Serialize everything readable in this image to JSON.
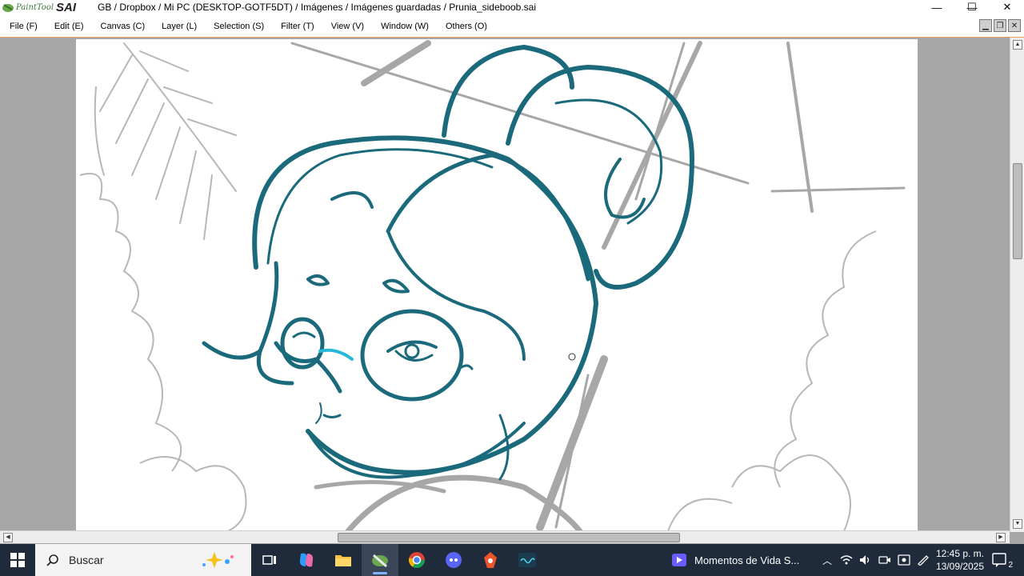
{
  "app": {
    "logo_text": "PaintTool",
    "logo_sai": "SAI",
    "title_path": "GB / Dropbox / Mi PC (DESKTOP-GOTF5DT) / Imágenes / Imágenes guardadas / Prunia_sideboob.sai"
  },
  "window_controls": {
    "minimize": "—",
    "maximize": "☐",
    "close": "✕"
  },
  "menu": [
    {
      "label": "File (F)"
    },
    {
      "label": "Edit (E)"
    },
    {
      "label": "Canvas (C)"
    },
    {
      "label": "Layer (L)"
    },
    {
      "label": "Selection (S)"
    },
    {
      "label": "Filter (T)"
    },
    {
      "label": "View (V)"
    },
    {
      "label": "Window (W)"
    },
    {
      "label": "Others (O)"
    }
  ],
  "colors": {
    "sketch_teal": "#1a6a7c",
    "sketch_gray": "#8a8a8a",
    "accent_cyan": "#2ab8d8",
    "workspace_gray": "#a7a7a7",
    "taskbar": "#1f2a3a"
  },
  "taskbar": {
    "search_placeholder": "Buscar",
    "apps": [
      {
        "name": "task-view-icon"
      },
      {
        "name": "copilot-icon"
      },
      {
        "name": "file-explorer-icon"
      },
      {
        "name": "painttool-sai-icon",
        "active": true
      },
      {
        "name": "chrome-icon"
      },
      {
        "name": "discord-icon"
      },
      {
        "name": "app-orange-icon"
      },
      {
        "name": "app-wave-icon"
      }
    ],
    "media_title": "Momentos de Vida S...",
    "clock_time": "12:45 p. m.",
    "clock_date": "13/09/2025",
    "notification_count": "2"
  }
}
